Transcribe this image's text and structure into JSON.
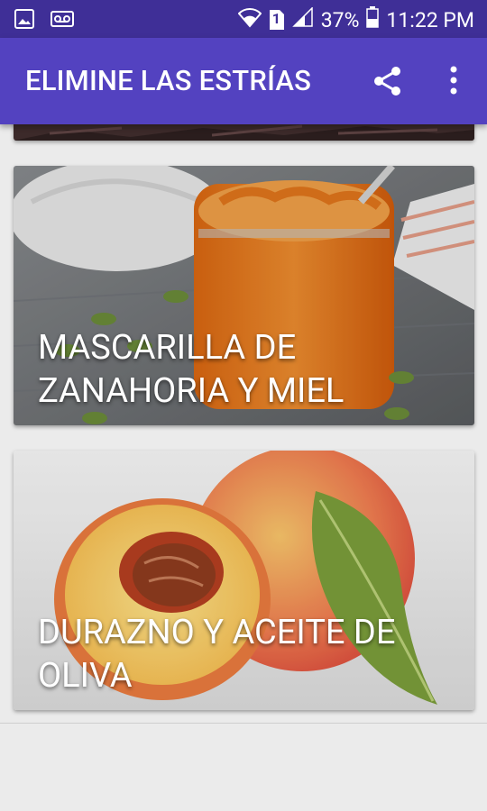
{
  "status_bar": {
    "battery": "37%",
    "time": "11:22 PM",
    "sim_slot": "1",
    "icons": [
      "image-icon",
      "voicemail-icon",
      "wifi-icon",
      "sim-icon",
      "signal-icon",
      "battery-icon"
    ]
  },
  "app_bar": {
    "title": "ELIMINE LAS ESTRÍAS",
    "actions": [
      "share-icon",
      "more-vert-icon"
    ],
    "color": "#5342c0"
  },
  "cards": [
    {
      "caption": ""
    },
    {
      "caption": "MASCARILLA DE ZANAHORIA Y MIEL"
    },
    {
      "caption": "DURAZNO Y ACEITE DE OLIVA"
    }
  ],
  "colors": {
    "status_bar": "#3f2f97",
    "app_bar": "#5342c0",
    "background": "#ebebeb"
  }
}
